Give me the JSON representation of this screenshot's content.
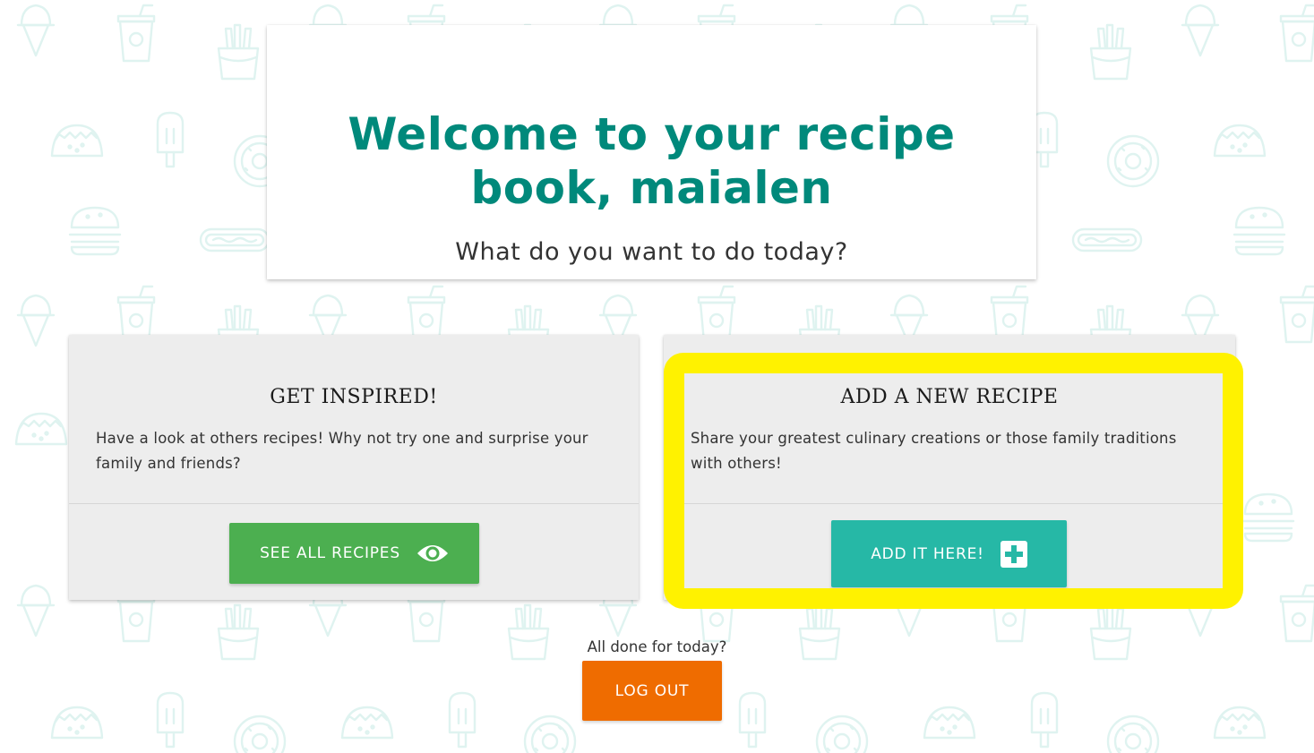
{
  "header": {
    "title": "Welcome to your recipe book, maialen",
    "subtitle": "What do you want to do today?"
  },
  "cards": {
    "inspire": {
      "title": "GET INSPIRED!",
      "text": "Have a look at others recipes! Why not try one and surprise your family and friends?",
      "button_label": "SEE ALL RECIPES",
      "button_icon": "eye-icon",
      "button_color": "#4caf50"
    },
    "add": {
      "title": "ADD A NEW RECIPE",
      "text": "Share your greatest culinary creations or those family traditions with others!",
      "button_label": "ADD IT HERE!",
      "button_icon": "plus-square-icon",
      "button_color": "#26b8a6"
    }
  },
  "logout": {
    "prompt": "All done for today?",
    "button_label": "LOG OUT",
    "button_color": "#ef6c00"
  },
  "colors": {
    "title_teal": "#00897b",
    "highlight": "#fff200",
    "card_background": "#ededed",
    "pattern": "#e3f6f3"
  },
  "background_pattern_icons": [
    "ice-cream-icon",
    "soda-cup-icon",
    "fries-icon",
    "taco-icon",
    "popsicle-icon",
    "donut-icon",
    "burger-icon",
    "hotdog-icon"
  ]
}
